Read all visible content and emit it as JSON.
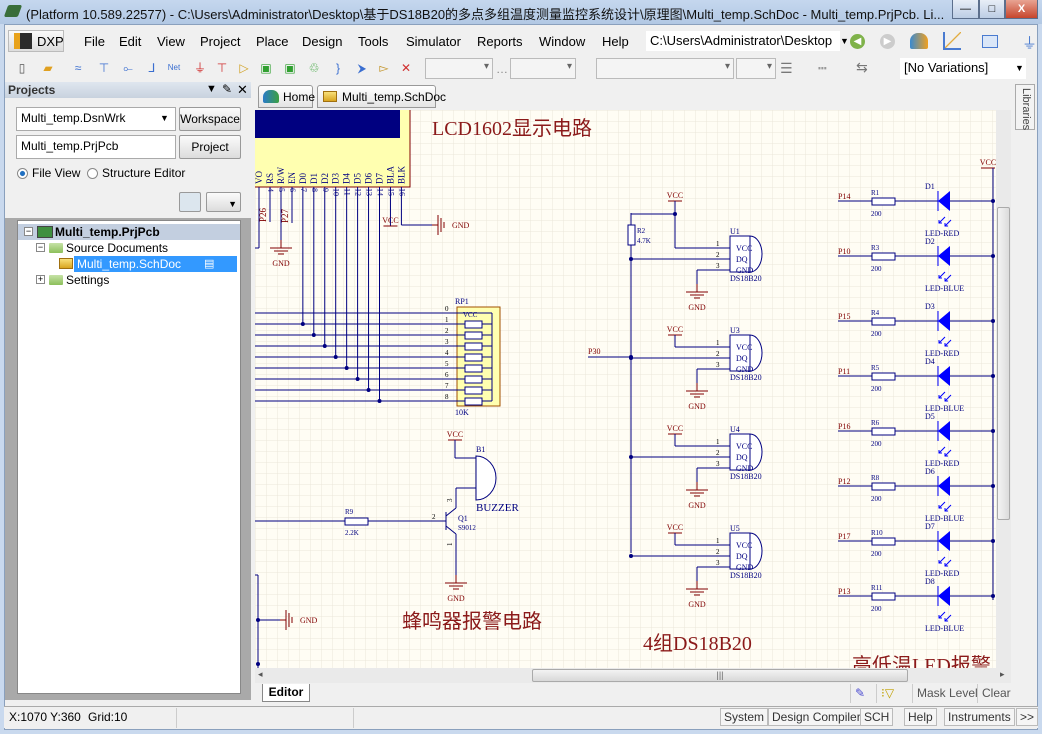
{
  "window": {
    "title": "(Platform 10.589.22577) - C:\\Users\\Administrator\\Desktop\\基于DS18B20的多点多组温度测量监控系统设计\\原理图\\Multi_temp.SchDoc - Multi_temp.PrjPcb. Li...",
    "controls": {
      "minimize": "—",
      "maximize": "□",
      "close": "X"
    }
  },
  "menubar": {
    "dxp": "DXP",
    "items": [
      "File",
      "Edit",
      "View",
      "Project",
      "Place",
      "Design",
      "Tools",
      "Simulator",
      "Reports",
      "Window",
      "Help"
    ],
    "path": "C:\\Users\\Administrator\\Desktop"
  },
  "toolbar": {
    "icons": [
      "new-file-icon",
      "open-folder-icon",
      "bus-icon",
      "bus-entry-icon",
      "wire-icon",
      "signal-harness-icon",
      "net-label-icon",
      "gnd-port-icon",
      "vcc-port-icon",
      "part-icon",
      "sheet-symbol-icon",
      "sheet-entry-icon",
      "device-sheet-icon",
      "harness-connector-icon",
      "port-icon",
      "off-sheet-connector-icon",
      "no-erc-icon"
    ],
    "variations": "[No Variations]"
  },
  "projects_panel": {
    "title": "Projects",
    "workspace_field": "Multi_temp.DsnWrk",
    "workspace_button": "Workspace",
    "project_field": "Multi_temp.PrjPcb",
    "project_button": "Project",
    "view_options": [
      {
        "label": "File View",
        "selected": true
      },
      {
        "label": "Structure Editor",
        "selected": false
      }
    ],
    "tree": {
      "project": "Multi_temp.PrjPcb",
      "source_folder": "Source Documents",
      "document": "Multi_temp.SchDoc",
      "settings": "Settings"
    }
  },
  "doc_tabs": {
    "home": "Home",
    "active": "Multi_temp.SchDoc"
  },
  "libraries_tab": "Libraries",
  "schematic": {
    "titles": {
      "lcd": "LCD1602显示电路",
      "buzzer": "蜂鸣器报警电路",
      "sensors": "4组DS18B20",
      "leds": "高低温LED报警"
    },
    "power": {
      "vcc": "VCC",
      "gnd": "GND"
    },
    "lcd": {
      "pins": [
        {
          "name": "VO",
          "num": ""
        },
        {
          "name": "RS",
          "num": "4"
        },
        {
          "name": "R/W",
          "num": "5"
        },
        {
          "name": "EN",
          "num": "6"
        },
        {
          "name": "D0",
          "num": "7"
        },
        {
          "name": "D1",
          "num": "8"
        },
        {
          "name": "D2",
          "num": "9"
        },
        {
          "name": "D3",
          "num": "10"
        },
        {
          "name": "D4",
          "num": "11"
        },
        {
          "name": "D5",
          "num": "12"
        },
        {
          "name": "D6",
          "num": "13"
        },
        {
          "name": "D7",
          "num": "14"
        },
        {
          "name": "BLA",
          "num": "15"
        },
        {
          "name": "BLK",
          "num": "16"
        }
      ],
      "net_labels": [
        "P26",
        "P27"
      ]
    },
    "rp1": {
      "ref": "RP1",
      "value": "10K",
      "common": "VCC",
      "pins": [
        "0",
        "1",
        "2",
        "3",
        "4",
        "5",
        "6",
        "7",
        "8"
      ]
    },
    "sensors": {
      "resistor": {
        "ref": "R2",
        "value": "4.7K"
      },
      "net": "P30",
      "pin_names": [
        "VCC",
        "DQ",
        "GND"
      ],
      "pin_numbers": [
        "1",
        "2",
        "3"
      ],
      "units": [
        {
          "ref": "U1",
          "part": "DS18B20"
        },
        {
          "ref": "U3",
          "part": "DS18B20"
        },
        {
          "ref": "U4",
          "part": "DS18B20"
        },
        {
          "ref": "U5",
          "part": "DS18B20"
        }
      ]
    },
    "buzzer": {
      "ref": "B1",
      "label": "BUZZER",
      "transistor": {
        "ref": "Q1",
        "part": "S9012",
        "pins": [
          "1",
          "2",
          "3"
        ]
      },
      "resistor": {
        "ref": "R9",
        "value": "2.2K"
      }
    },
    "leds": [
      {
        "net": "P14",
        "res": "R1",
        "value": "200",
        "diode": "D1",
        "type": "LED-RED"
      },
      {
        "net": "P10",
        "res": "R3",
        "value": "200",
        "diode": "D2",
        "type": "LED-BLUE"
      },
      {
        "net": "P15",
        "res": "R4",
        "value": "200",
        "diode": "D3",
        "type": "LED-RED"
      },
      {
        "net": "P11",
        "res": "R5",
        "value": "200",
        "diode": "D4",
        "type": "LED-BLUE"
      },
      {
        "net": "P16",
        "res": "R6",
        "value": "200",
        "diode": "D5",
        "type": "LED-RED"
      },
      {
        "net": "P12",
        "res": "R8",
        "value": "200",
        "diode": "D6",
        "type": "LED-BLUE"
      },
      {
        "net": "P17",
        "res": "R10",
        "value": "200",
        "diode": "D7",
        "type": "LED-RED"
      },
      {
        "net": "P13",
        "res": "R11",
        "value": "200",
        "diode": "D8",
        "type": "LED-BLUE"
      }
    ],
    "colors": {
      "wire": "#000080",
      "power": "#800000",
      "body": "#ffffb0",
      "title": "#8b1a1a",
      "led": "#0000ff"
    }
  },
  "editor_tab": "Editor",
  "filter_bar": {
    "mask_level": "Mask Level",
    "clear": "Clear"
  },
  "status": {
    "coords": "X:1070 Y:360",
    "grid": "Grid:10"
  },
  "status_buttons": [
    "System",
    "Design Compiler",
    "SCH",
    "Help",
    "Instruments",
    ">>"
  ]
}
